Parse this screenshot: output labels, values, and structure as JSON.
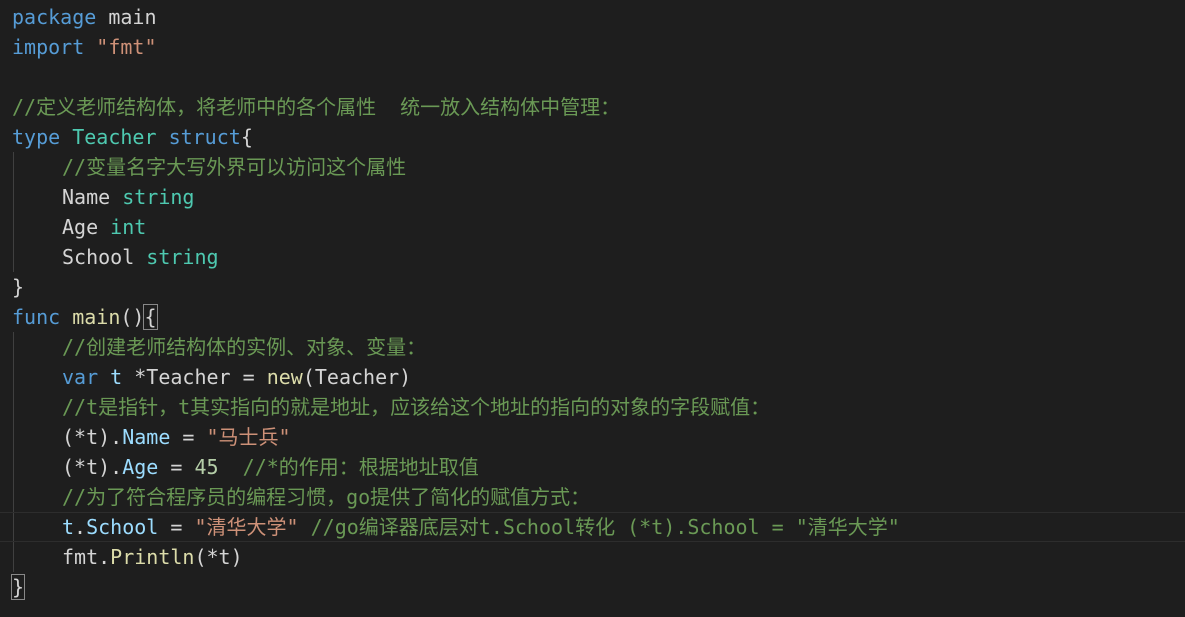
{
  "editor": {
    "lines": [
      {
        "tokens": [
          {
            "t": "package",
            "c": "kw"
          },
          {
            "t": " main",
            "c": "plain"
          }
        ]
      },
      {
        "tokens": [
          {
            "t": "import",
            "c": "kw"
          },
          {
            "t": " ",
            "c": "plain"
          },
          {
            "t": "\"fmt\"",
            "c": "str"
          }
        ]
      },
      {
        "tokens": []
      },
      {
        "tokens": [
          {
            "t": "//定义老师结构体，将老师中的各个属性  统一放入结构体中管理：",
            "c": "cmt"
          }
        ]
      },
      {
        "tokens": [
          {
            "t": "type",
            "c": "kw"
          },
          {
            "t": " ",
            "c": "plain"
          },
          {
            "t": "Teacher",
            "c": "type"
          },
          {
            "t": " ",
            "c": "plain"
          },
          {
            "t": "struct",
            "c": "kw"
          },
          {
            "t": "{",
            "c": "plain"
          }
        ]
      },
      {
        "indent": 1,
        "guide": true,
        "tokens": [
          {
            "t": "//变量名字大写外界可以访问这个属性",
            "c": "cmt"
          }
        ]
      },
      {
        "indent": 1,
        "guide": true,
        "tokens": [
          {
            "t": "Name",
            "c": "plain"
          },
          {
            "t": " ",
            "c": "plain"
          },
          {
            "t": "string",
            "c": "type"
          }
        ]
      },
      {
        "indent": 1,
        "guide": true,
        "tokens": [
          {
            "t": "Age",
            "c": "plain"
          },
          {
            "t": " ",
            "c": "plain"
          },
          {
            "t": "int",
            "c": "type"
          }
        ]
      },
      {
        "indent": 1,
        "guide": true,
        "tokens": [
          {
            "t": "School",
            "c": "plain"
          },
          {
            "t": " ",
            "c": "plain"
          },
          {
            "t": "string",
            "c": "type"
          }
        ]
      },
      {
        "tokens": [
          {
            "t": "}",
            "c": "plain"
          }
        ]
      },
      {
        "tokens": [
          {
            "t": "func",
            "c": "kw"
          },
          {
            "t": " ",
            "c": "plain"
          },
          {
            "t": "main",
            "c": "fn"
          },
          {
            "t": "()",
            "c": "plain"
          },
          {
            "t": "{",
            "c": "plain",
            "match": true
          }
        ]
      },
      {
        "indent": 1,
        "guide": true,
        "tokens": [
          {
            "t": "//创建老师结构体的实例、对象、变量：",
            "c": "cmt"
          }
        ]
      },
      {
        "indent": 1,
        "guide": true,
        "tokens": [
          {
            "t": "var",
            "c": "kw"
          },
          {
            "t": " ",
            "c": "plain"
          },
          {
            "t": "t",
            "c": "var"
          },
          {
            "t": " *Teacher = ",
            "c": "plain"
          },
          {
            "t": "new",
            "c": "fn"
          },
          {
            "t": "(Teacher)",
            "c": "plain"
          }
        ]
      },
      {
        "indent": 1,
        "guide": true,
        "tokens": [
          {
            "t": "//t是指针，t其实指向的就是地址，应该给这个地址的指向的对象的字段赋值：",
            "c": "cmt"
          }
        ]
      },
      {
        "indent": 1,
        "guide": true,
        "tokens": [
          {
            "t": "(*t).",
            "c": "plain"
          },
          {
            "t": "Name",
            "c": "var"
          },
          {
            "t": " = ",
            "c": "plain"
          },
          {
            "t": "\"马士兵\"",
            "c": "str"
          }
        ]
      },
      {
        "indent": 1,
        "guide": true,
        "tokens": [
          {
            "t": "(*t).",
            "c": "plain"
          },
          {
            "t": "Age",
            "c": "var"
          },
          {
            "t": " = ",
            "c": "plain"
          },
          {
            "t": "45",
            "c": "num"
          },
          {
            "t": "  ",
            "c": "plain"
          },
          {
            "t": "//*的作用：根据地址取值",
            "c": "cmt"
          }
        ]
      },
      {
        "indent": 1,
        "guide": true,
        "tokens": [
          {
            "t": "//为了符合程序员的编程习惯，go提供了简化的赋值方式：",
            "c": "cmt"
          }
        ]
      },
      {
        "indent": 1,
        "guide": true,
        "current": true,
        "tokens": [
          {
            "t": "t",
            "c": "var"
          },
          {
            "t": ".",
            "c": "plain"
          },
          {
            "t": "School",
            "c": "var"
          },
          {
            "t": " = ",
            "c": "plain"
          },
          {
            "t": "\"清华大学\"",
            "c": "str"
          },
          {
            "t": " ",
            "c": "plain"
          },
          {
            "t": "//go编译器底层对t.School转化 (*t).School = \"清华大学\"",
            "c": "cmt"
          }
        ]
      },
      {
        "indent": 1,
        "guide": true,
        "tokens": [
          {
            "t": "fmt",
            "c": "plain"
          },
          {
            "t": ".",
            "c": "plain"
          },
          {
            "t": "Println",
            "c": "fn"
          },
          {
            "t": "(*t)",
            "c": "plain"
          }
        ]
      },
      {
        "tokens": [
          {
            "t": "}",
            "c": "plain",
            "match": true
          }
        ]
      }
    ]
  }
}
